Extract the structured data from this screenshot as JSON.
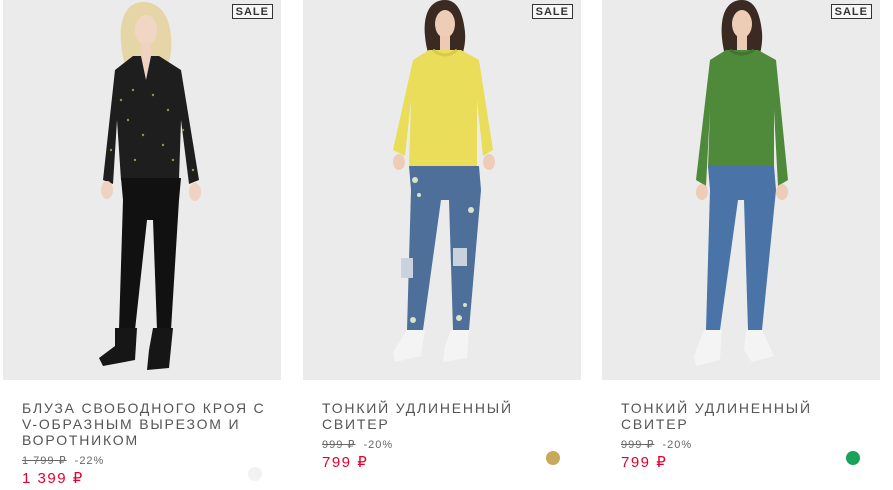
{
  "products": [
    {
      "badge": "SALE",
      "name": "БЛУЗА СВОБОДНОГО КРОЯ С V-ОБРАЗНЫМ ВЫРЕЗОМ И ВОРОТНИКОМ",
      "old_price": "1 799 ₽",
      "discount": "-22%",
      "price": "1 399 ₽",
      "swatch_color": "#f2f2f2",
      "photo_bg": "#ebebeb"
    },
    {
      "badge": "SALE",
      "name": "ТОНКИЙ УДЛИНЕННЫЙ СВИТЕР",
      "old_price": "999 ₽",
      "discount": "-20%",
      "price": "799 ₽",
      "swatch_color": "#c8a95a",
      "photo_bg": "#ebebeb"
    },
    {
      "badge": "SALE",
      "name": "ТОНКИЙ УДЛИНЕННЫЙ СВИТЕР",
      "old_price": "999 ₽",
      "discount": "-20%",
      "price": "799 ₽",
      "swatch_color": "#1aa15a",
      "photo_bg": "#ebebeb"
    }
  ],
  "colors": {
    "price_red": "#e4002b",
    "text_grey": "#555555"
  }
}
